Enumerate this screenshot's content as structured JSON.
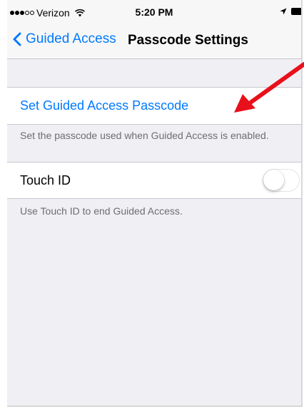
{
  "status_bar": {
    "carrier": "Verizon",
    "signal_bars_filled": 3,
    "signal_bars_total": 5,
    "time": "5:20 PM",
    "icons": [
      "wifi-icon",
      "location-arrow-icon",
      "battery-icon"
    ]
  },
  "nav": {
    "back_label": "Guided Access",
    "title": "Passcode Settings"
  },
  "sections": {
    "passcode": {
      "cell_label": "Set Guided Access Passcode",
      "footer": "Set the passcode used when Guided Access is enabled."
    },
    "touch_id": {
      "cell_label": "Touch ID",
      "toggle_on": false,
      "footer": "Use Touch ID to end Guided Access."
    }
  },
  "colors": {
    "accent": "#007aff",
    "background": "#efeff4",
    "annotation_arrow": "#e8101a"
  },
  "annotation": {
    "arrow_target": "Set Guided Access Passcode"
  }
}
